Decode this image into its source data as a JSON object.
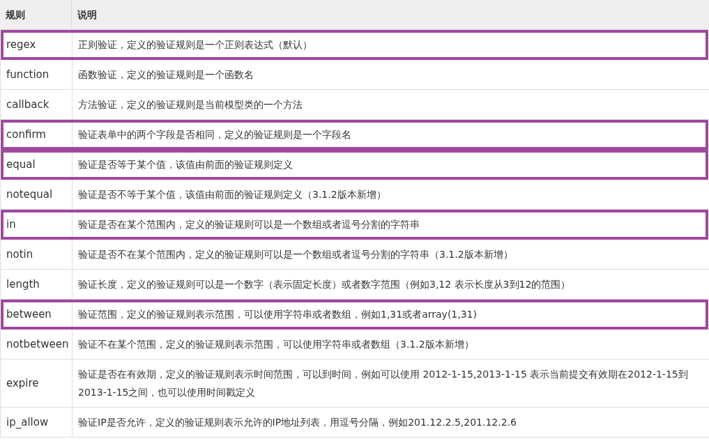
{
  "table": {
    "columns": [
      "规则",
      "说明"
    ],
    "rows": [
      {
        "rule": "regex",
        "description": "正则验证，定义的验证规则是一个正则表达式（默认）",
        "highlighted": true
      },
      {
        "rule": "function",
        "description": "函数验证，定义的验证规则是一个函数名",
        "highlighted": false
      },
      {
        "rule": "callback",
        "description": "方法验证，定义的验证规则是当前模型类的一个方法",
        "highlighted": false
      },
      {
        "rule": "confirm",
        "description": "验证表单中的两个字段是否相同，定义的验证规则是一个字段名",
        "highlighted": true
      },
      {
        "rule": "equal",
        "description": "验证是否等于某个值，该值由前面的验证规则定义",
        "highlighted": true
      },
      {
        "rule": "notequal",
        "description": "验证是否不等于某个值，该值由前面的验证规则定义（3.1.2版本新增）",
        "highlighted": false
      },
      {
        "rule": "in",
        "description": "验证是否在某个范围内，定义的验证规则可以是一个数组或者逗号分割的字符串",
        "highlighted": true
      },
      {
        "rule": "notin",
        "description": "验证是否不在某个范围内，定义的验证规则可以是一个数组或者逗号分割的字符串（3.1.2版本新增）",
        "highlighted": false
      },
      {
        "rule": "length",
        "description": "验证长度，定义的验证规则可以是一个数字（表示固定长度）或者数字范围（例如3,12 表示长度从3到12的范围）",
        "highlighted": false
      },
      {
        "rule": "between",
        "description": "验证范围，定义的验证规则表示范围，可以使用字符串或者数组，例如1,31或者array(1,31)",
        "highlighted": true
      },
      {
        "rule": "notbetween",
        "description": "验证不在某个范围，定义的验证规则表示范围，可以使用字符串或者数组（3.1.2版本新增）",
        "highlighted": false
      },
      {
        "rule": "expire",
        "description": "验证是否在有效期，定义的验证规则表示时间范围，可以到时间，例如可以使用 2012-1-15,2013-1-15 表示当前提交有效期在2012-1-15到2013-1-15之间，也可以使用时间戳定义",
        "highlighted": false
      },
      {
        "rule": "ip_allow",
        "description": "验证IP是否允许，定义的验证规则表示允许的IP地址列表，用逗号分隔，例如201.12.2.5,201.12.2.6",
        "highlighted": false
      }
    ]
  }
}
